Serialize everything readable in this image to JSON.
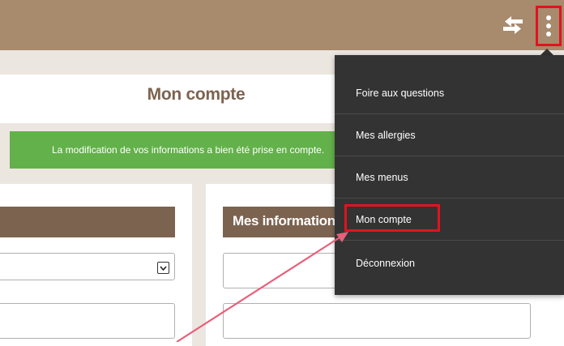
{
  "page": {
    "title": "Mon compte",
    "success_message": "La modification de vos informations a bien été prise en compte."
  },
  "header": {
    "swap_icon": "swap-arrows-icon",
    "menu_icon": "kebab-menu-icon"
  },
  "cards": {
    "right_heading": "Mes informations"
  },
  "menu": {
    "items": [
      {
        "label": "Foire aux questions"
      },
      {
        "label": "Mes allergies"
      },
      {
        "label": "Mes menus"
      },
      {
        "label": "Mon compte"
      },
      {
        "label": "Déconnexion"
      }
    ]
  },
  "colors": {
    "topbar": "#a88a6d",
    "brown": "#7c6350",
    "success": "#63b14a",
    "menu_bg": "#333333",
    "annotation_red": "#e0141e",
    "annotation_arrow": "#e8607a"
  }
}
